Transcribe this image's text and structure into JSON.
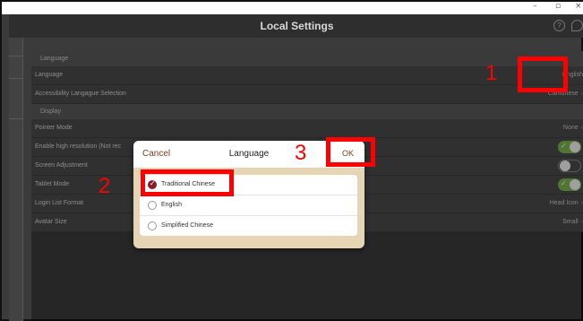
{
  "window": {
    "minimize": "–",
    "maximize": "▫",
    "close": "×"
  },
  "titlebar": {
    "title": "Local Settings",
    "help": "?"
  },
  "sections": {
    "language": "Language",
    "display": "Display"
  },
  "rows": {
    "language": {
      "label": "Language",
      "value": "English"
    },
    "accessibility": {
      "label": "Accessibility Langague Selection",
      "value": "Cantonese"
    },
    "pointer": {
      "label": "Pointer Mode",
      "value": "None"
    },
    "highres": {
      "label": "Enable high resolution (Not rec",
      "toggle": "on"
    },
    "screen": {
      "label": "Screen Adjustment",
      "toggle": "off"
    },
    "tablet": {
      "label": "Tablet Mode",
      "toggle": "on"
    },
    "loginlist": {
      "label": "Login List Format",
      "value": "Head Icon"
    },
    "avatar": {
      "label": "Avatar Size",
      "value": "Small"
    }
  },
  "dialog": {
    "cancel": "Cancel",
    "title": "Language",
    "ok": "OK",
    "options": [
      {
        "label": "Traditional Chinese",
        "selected": true
      },
      {
        "label": "English",
        "selected": false
      },
      {
        "label": "Simplified Chinese",
        "selected": false
      }
    ]
  },
  "annotations": {
    "one": "1",
    "two": "2",
    "three": "3"
  },
  "colors": {
    "highlight": "#ff0000",
    "toggle_on": "#7ab64d",
    "accent": "#7b3f1e"
  }
}
